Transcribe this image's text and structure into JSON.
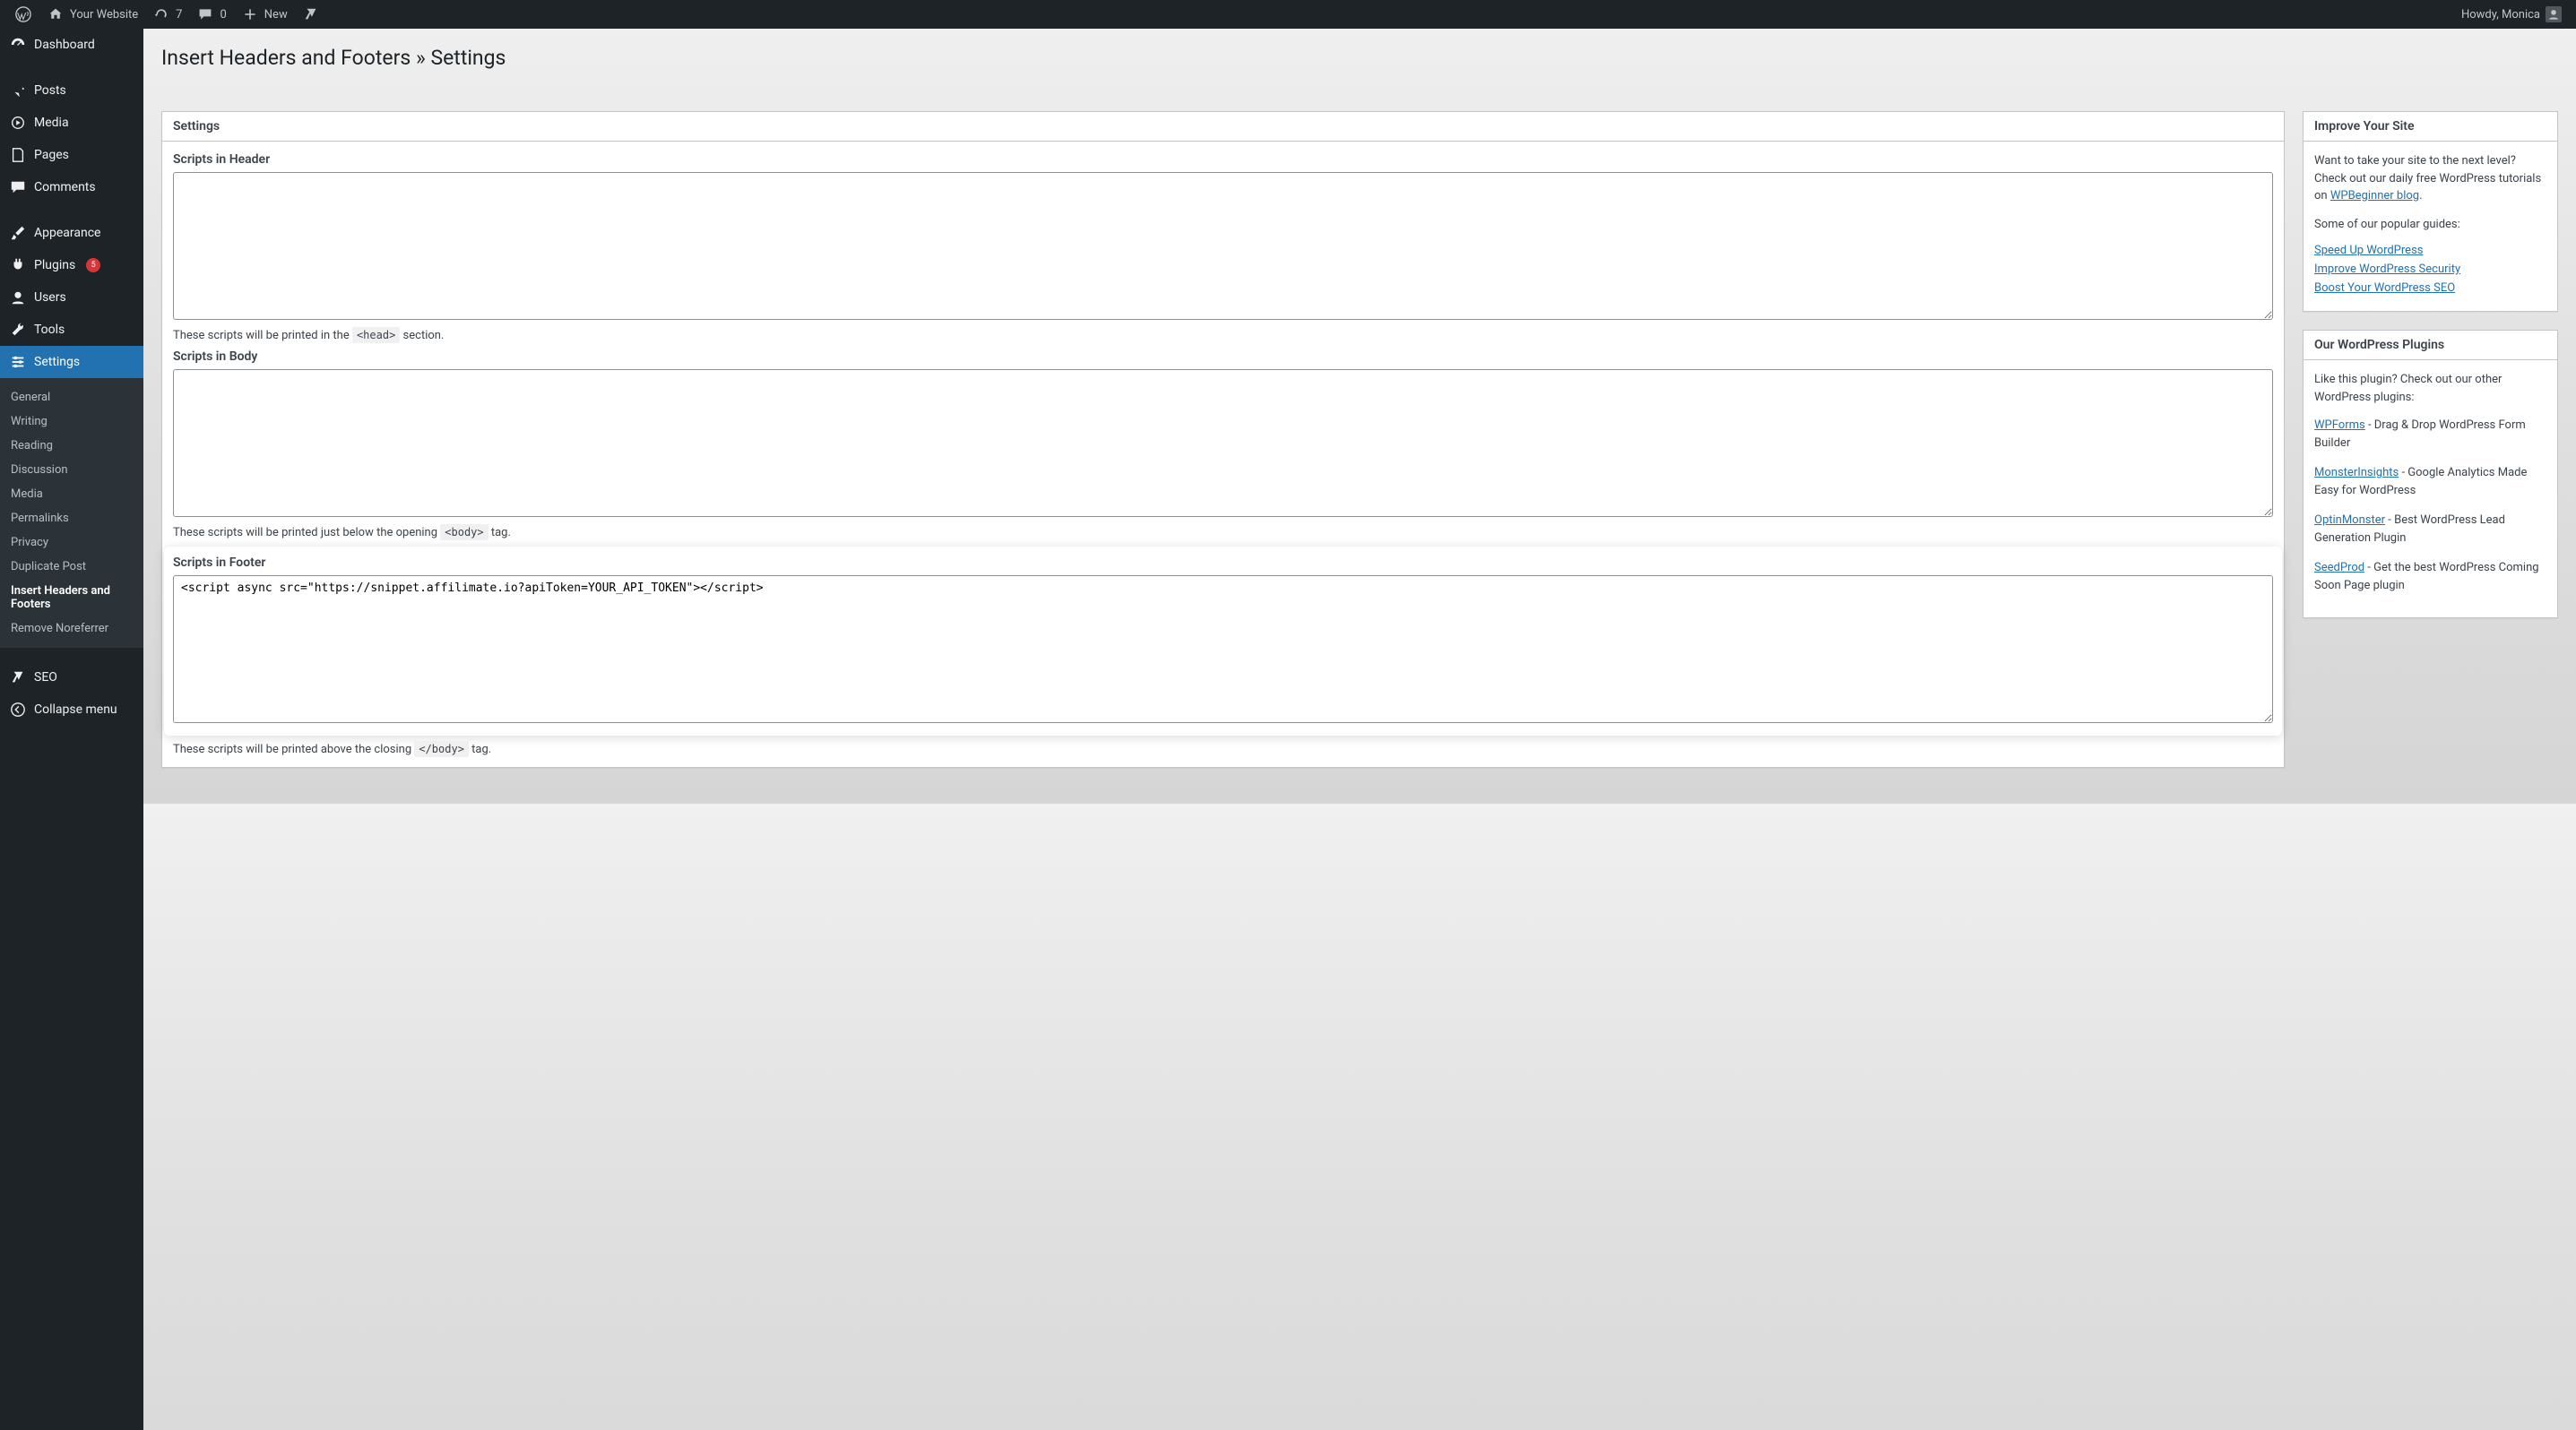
{
  "adminbar": {
    "site_name": "Your Website",
    "updates": "7",
    "comments": "0",
    "new": "New",
    "howdy": "Howdy, Monica"
  },
  "sidebar": {
    "dashboard": "Dashboard",
    "posts": "Posts",
    "media": "Media",
    "pages": "Pages",
    "comments": "Comments",
    "appearance": "Appearance",
    "plugins": "Plugins",
    "plugins_badge": "5",
    "users": "Users",
    "tools": "Tools",
    "settings": "Settings",
    "seo": "SEO",
    "collapse": "Collapse menu",
    "submenu": {
      "general": "General",
      "writing": "Writing",
      "reading": "Reading",
      "discussion": "Discussion",
      "media": "Media",
      "permalinks": "Permalinks",
      "privacy": "Privacy",
      "duplicate_post": "Duplicate Post",
      "insert_hf": "Insert Headers and Footers",
      "remove_noreferrer": "Remove Noreferrer"
    }
  },
  "page": {
    "title": "Insert Headers and Footers » Settings"
  },
  "form": {
    "panel_title": "Settings",
    "header_label": "Scripts in Header",
    "header_value": "",
    "header_help_pre": "These scripts will be printed in the ",
    "header_help_code": "<head>",
    "header_help_post": " section.",
    "body_label": "Scripts in Body",
    "body_value": "",
    "body_help_pre": "These scripts will be printed just below the opening ",
    "body_help_code": "<body>",
    "body_help_post": " tag.",
    "footer_label": "Scripts in Footer",
    "footer_value": "<script async src=\"https://snippet.affilimate.io?apiToken=YOUR_API_TOKEN\"></script>",
    "footer_help_pre": "These scripts will be printed above the closing ",
    "footer_help_code": "</body>",
    "footer_help_post": " tag."
  },
  "sidebar_boxes": {
    "improve": {
      "title": "Improve Your Site",
      "intro_pre": "Want to take your site to the next level? Check out our daily free WordPress tutorials on ",
      "intro_link": "WPBeginner blog",
      "intro_post": ".",
      "guides_heading": "Some of our popular guides:",
      "link1": "Speed Up WordPress",
      "link2": "Improve WordPress Security",
      "link3": "Boost Your WordPress SEO"
    },
    "plugins": {
      "title": "Our WordPress Plugins",
      "intro": "Like this plugin? Check out our other WordPress plugins:",
      "wpforms": "WPForms",
      "wpforms_desc": " - Drag & Drop WordPress Form Builder",
      "monster": "MonsterInsights",
      "monster_desc": " - Google Analytics Made Easy for WordPress",
      "optin": "OptinMonster",
      "optin_desc": " - Best WordPress Lead Generation Plugin",
      "seedprod": "SeedProd",
      "seedprod_desc": " - Get the best WordPress Coming Soon Page plugin"
    }
  }
}
